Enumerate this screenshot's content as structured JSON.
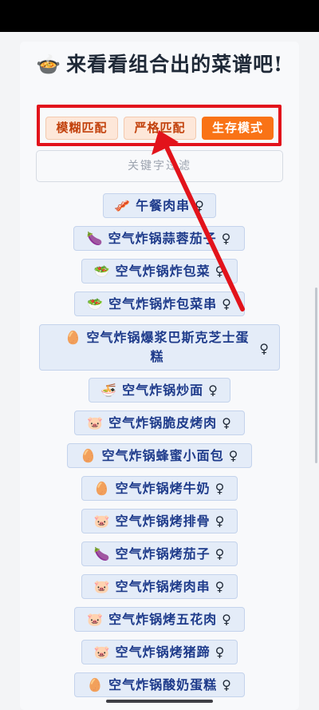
{
  "header": {
    "pot_icon": "🍲",
    "title": "来看看组合出的菜谱吧!"
  },
  "modes": [
    {
      "label": "模糊匹配",
      "active": false
    },
    {
      "label": "严格匹配",
      "active": false
    },
    {
      "label": "生存模式",
      "active": true
    }
  ],
  "filter": {
    "placeholder": "关键字过滤"
  },
  "gender_icon": "♀",
  "recipes": [
    {
      "icon": "🥓",
      "name": "午餐肉串"
    },
    {
      "icon": "🍆",
      "name": "空气炸锅蒜蓉茄子"
    },
    {
      "icon": "🥗",
      "name": "空气炸锅炸包菜"
    },
    {
      "icon": "🥗",
      "name": "空气炸锅炸包菜串"
    },
    {
      "icon": "🥚",
      "name": "空气炸锅爆浆巴斯克芝士蛋糕"
    },
    {
      "icon": "🍜",
      "name": "空气炸锅炒面"
    },
    {
      "icon": "🐷",
      "name": "空气炸锅脆皮烤肉"
    },
    {
      "icon": "🥚",
      "name": "空气炸锅蜂蜜小面包"
    },
    {
      "icon": "🥚",
      "name": "空气炸锅烤牛奶"
    },
    {
      "icon": "🐷",
      "name": "空气炸锅烤排骨"
    },
    {
      "icon": "🍆",
      "name": "空气炸锅烤茄子"
    },
    {
      "icon": "🐷",
      "name": "空气炸锅烤肉串"
    },
    {
      "icon": "🐷",
      "name": "空气炸锅烤五花肉"
    },
    {
      "icon": "🐷",
      "name": "空气炸锅烤猪蹄"
    },
    {
      "icon": "🥚",
      "name": "空气炸锅酸奶蛋糕"
    }
  ],
  "colors": {
    "highlight_box": "#e2131b",
    "arrow": "#e2131b",
    "active_mode": "#f97316"
  }
}
